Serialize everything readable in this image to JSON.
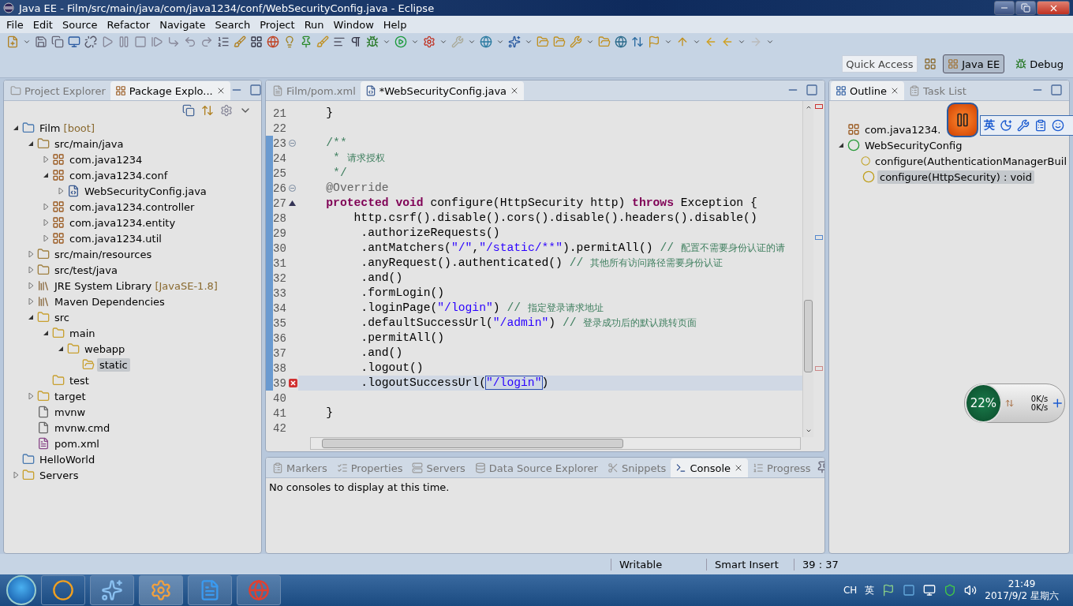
{
  "window": {
    "title": "Java EE - Film/src/main/java/com/java1234/conf/WebSecurityConfig.java - Eclipse"
  },
  "menu": [
    "File",
    "Edit",
    "Source",
    "Refactor",
    "Navigate",
    "Search",
    "Project",
    "Run",
    "Window",
    "Help"
  ],
  "quick_access": {
    "placeholder": "Quick Access"
  },
  "perspectives": [
    {
      "label": "Java EE",
      "selected": true
    },
    {
      "label": "Debug",
      "selected": false
    }
  ],
  "explorer": {
    "tabs": [
      {
        "label": "Project Explorer",
        "selected": false
      },
      {
        "label": "Package Explo...",
        "selected": true
      }
    ],
    "tree": [
      {
        "label": "Film",
        "decoration": "[boot]",
        "kind": "project",
        "expanded": true,
        "selected": false,
        "children": [
          {
            "label": "src/main/java",
            "kind": "srcfolder",
            "expanded": true,
            "selected": false,
            "children": [
              {
                "label": "com.java1234",
                "kind": "package",
                "expanded": false,
                "selected": false
              },
              {
                "label": "com.java1234.conf",
                "kind": "package",
                "expanded": true,
                "selected": false,
                "children": [
                  {
                    "label": "WebSecurityConfig.java",
                    "kind": "javafile",
                    "expanded": false,
                    "selected": false
                  }
                ]
              },
              {
                "label": "com.java1234.controller",
                "kind": "package",
                "expanded": false,
                "selected": false
              },
              {
                "label": "com.java1234.entity",
                "kind": "package",
                "expanded": false,
                "selected": false
              },
              {
                "label": "com.java1234.util",
                "kind": "package",
                "expanded": false,
                "selected": false
              }
            ]
          },
          {
            "label": "src/main/resources",
            "kind": "srcfolder",
            "expanded": false,
            "selected": false
          },
          {
            "label": "src/test/java",
            "kind": "srcfolder",
            "expanded": false,
            "selected": false
          },
          {
            "label": "JRE System Library",
            "decoration": "[JavaSE-1.8]",
            "kind": "library",
            "expanded": false,
            "selected": false
          },
          {
            "label": "Maven Dependencies",
            "kind": "library",
            "expanded": false,
            "selected": false
          },
          {
            "label": "src",
            "kind": "folder",
            "expanded": true,
            "selected": false,
            "children": [
              {
                "label": "main",
                "kind": "folder",
                "expanded": true,
                "selected": false,
                "children": [
                  {
                    "label": "webapp",
                    "kind": "folder",
                    "expanded": true,
                    "selected": false,
                    "children": [
                      {
                        "label": "static",
                        "kind": "openfolder",
                        "selected": true
                      }
                    ]
                  }
                ]
              },
              {
                "label": "test",
                "kind": "folder",
                "selected": false
              }
            ]
          },
          {
            "label": "target",
            "kind": "folder",
            "expanded": false,
            "selected": false
          },
          {
            "label": "mvnw",
            "kind": "file",
            "selected": false
          },
          {
            "label": "mvnw.cmd",
            "kind": "file",
            "selected": false
          },
          {
            "label": "pom.xml",
            "kind": "xml",
            "selected": false
          }
        ]
      },
      {
        "label": "HelloWorld",
        "kind": "project",
        "selected": false
      },
      {
        "label": "Servers",
        "kind": "folder",
        "expanded": false,
        "selected": false
      }
    ]
  },
  "editor": {
    "tabs": [
      {
        "label": "Film/pom.xml",
        "kind": "xml",
        "selected": false
      },
      {
        "label": "*WebSecurityConfig.java",
        "kind": "java",
        "selected": true
      }
    ],
    "lines": [
      {
        "number": "21",
        "changed": false,
        "current": false,
        "tokens": [
          {
            "kind": "plain",
            "text": "    }"
          }
        ]
      },
      {
        "number": "22",
        "changed": false,
        "current": false
      },
      {
        "number": "23",
        "changed": true,
        "current": false,
        "kind": "fold",
        "tokens": [
          {
            "kind": "comment",
            "text": "    /**"
          }
        ]
      },
      {
        "number": "24",
        "changed": true,
        "current": false,
        "tokens": [
          {
            "kind": "comment",
            "text": "     * "
          },
          {
            "kind": "cjk",
            "text": "请求授权"
          }
        ]
      },
      {
        "number": "25",
        "changed": true,
        "current": false,
        "tokens": [
          {
            "kind": "comment",
            "text": "     */"
          }
        ]
      },
      {
        "number": "26",
        "changed": true,
        "current": false,
        "kind": "fold",
        "tokens": [
          {
            "kind": "annotation",
            "text": "    @Override"
          }
        ]
      },
      {
        "number": "27",
        "changed": true,
        "current": false,
        "kind": "override",
        "tokens": [
          {
            "kind": "keyword",
            "text": "    protected"
          },
          {
            "kind": "keyword",
            "text": " void"
          },
          {
            "kind": "plain",
            "text": " configure(HttpSecurity http) "
          },
          {
            "kind": "keyword",
            "text": "throws"
          },
          {
            "kind": "plain",
            "text": " Exception {"
          }
        ]
      },
      {
        "number": "28",
        "changed": true,
        "current": false,
        "tokens": [
          {
            "kind": "plain",
            "text": "        http.csrf().disable().cors().disable().headers().disable()"
          }
        ]
      },
      {
        "number": "29",
        "changed": true,
        "current": false,
        "tokens": [
          {
            "kind": "plain",
            "text": "         .authorizeRequests()"
          }
        ]
      },
      {
        "number": "30",
        "changed": true,
        "current": false,
        "tokens": [
          {
            "kind": "plain",
            "text": "         .antMatchers("
          },
          {
            "kind": "string",
            "text": "\"/\""
          },
          {
            "kind": "plain",
            "text": ","
          },
          {
            "kind": "string",
            "text": "\"/static/**\""
          },
          {
            "kind": "plain",
            "text": ").permitAll() "
          },
          {
            "kind": "comment",
            "text": "// "
          },
          {
            "kind": "cjk",
            "text": "配置不需要身份认证的请"
          }
        ]
      },
      {
        "number": "31",
        "changed": true,
        "current": false,
        "tokens": [
          {
            "kind": "plain",
            "text": "         .anyRequest().authenticated() "
          },
          {
            "kind": "comment",
            "text": "// "
          },
          {
            "kind": "cjk",
            "text": "其他所有访问路径需要身份认证"
          }
        ]
      },
      {
        "number": "32",
        "changed": true,
        "current": false,
        "tokens": [
          {
            "kind": "plain",
            "text": "         .and()"
          }
        ]
      },
      {
        "number": "33",
        "changed": true,
        "current": false,
        "tokens": [
          {
            "kind": "plain",
            "text": "         .formLogin()"
          }
        ]
      },
      {
        "number": "34",
        "changed": true,
        "current": false,
        "tokens": [
          {
            "kind": "plain",
            "text": "         .loginPage("
          },
          {
            "kind": "string",
            "text": "\"/login\""
          },
          {
            "kind": "plain",
            "text": ") "
          },
          {
            "kind": "comment",
            "text": "// "
          },
          {
            "kind": "cjk",
            "text": "指定登录请求地址"
          }
        ]
      },
      {
        "number": "35",
        "changed": true,
        "current": false,
        "tokens": [
          {
            "kind": "plain",
            "text": "         .defaultSuccessUrl("
          },
          {
            "kind": "string",
            "text": "\"/admin\""
          },
          {
            "kind": "plain",
            "text": ") "
          },
          {
            "kind": "comment",
            "text": "// "
          },
          {
            "kind": "cjk",
            "text": "登录成功后的默认跳转页面"
          }
        ]
      },
      {
        "number": "36",
        "changed": true,
        "current": false,
        "tokens": [
          {
            "kind": "plain",
            "text": "         .permitAll()"
          }
        ]
      },
      {
        "number": "37",
        "changed": true,
        "current": false,
        "tokens": [
          {
            "kind": "plain",
            "text": "         .and()"
          }
        ]
      },
      {
        "number": "38",
        "changed": true,
        "current": false,
        "tokens": [
          {
            "kind": "plain",
            "text": "         .logout()"
          }
        ]
      },
      {
        "number": "39",
        "changed": true,
        "current": true,
        "kind": "error",
        "tokens": [
          {
            "kind": "plain",
            "text": "         .logoutSuccessUrl("
          },
          {
            "kind": "linked",
            "text": "\"/login\""
          },
          {
            "kind": "plain",
            "text": ")"
          }
        ]
      },
      {
        "number": "40",
        "changed": false,
        "current": false
      },
      {
        "number": "41",
        "changed": false,
        "current": false,
        "tokens": [
          {
            "kind": "plain",
            "text": "    }"
          }
        ]
      },
      {
        "number": "42",
        "changed": false,
        "current": false
      }
    ]
  },
  "outline": {
    "tabs": [
      {
        "label": "Outline",
        "selected": true
      },
      {
        "label": "Task List",
        "selected": false
      }
    ],
    "tree": [
      {
        "label": "com.java1234.",
        "kind": "package",
        "selected": false
      },
      {
        "label": "WebSecurityConfig",
        "kind": "class",
        "expanded": true,
        "selected": false,
        "children": [
          {
            "label": "configure(AuthenticationManagerBuil",
            "kind": "method",
            "selected": false
          },
          {
            "label": "configure(HttpSecurity) : void",
            "kind": "method",
            "selected": true
          }
        ]
      }
    ]
  },
  "console": {
    "tabs": [
      {
        "label": "Markers",
        "selected": false
      },
      {
        "label": "Properties",
        "selected": false
      },
      {
        "label": "Servers",
        "selected": false
      },
      {
        "label": "Data Source Explorer",
        "selected": false
      },
      {
        "label": "Snippets",
        "selected": false
      },
      {
        "label": "Console",
        "selected": true
      },
      {
        "label": "Progress",
        "selected": false
      }
    ],
    "message": "No consoles to display at this time."
  },
  "status_bar": [
    "Writable",
    "Smart Insert",
    "39 : 37"
  ],
  "ime_bar": {
    "language": "英"
  },
  "net_meter": {
    "percent": "22%",
    "upload": "0K/s",
    "download": "0K/s"
  },
  "taskbar": {
    "input": "CH",
    "ime": "英",
    "time": "21:49",
    "date": "2017/9/2 星期六"
  }
}
